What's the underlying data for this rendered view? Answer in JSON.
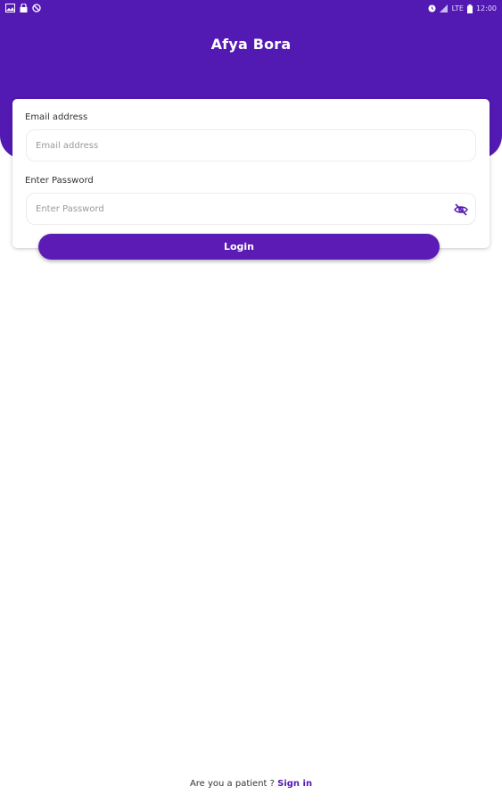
{
  "status_bar": {
    "left_icons": [
      "image-icon",
      "lock-icon",
      "no-sync-icon"
    ],
    "right_icons": [
      "alarm-icon",
      "signal-icon",
      "battery-icon"
    ],
    "network_label": "LTE",
    "time": "12:00"
  },
  "header": {
    "title": "Afya Bora",
    "background_color": "#5319b3"
  },
  "form": {
    "email": {
      "label": "Email address",
      "placeholder": "Email address",
      "value": ""
    },
    "password": {
      "label": "Enter Password",
      "placeholder": "Enter Password",
      "value": "",
      "toggle_icon": "eye-off-icon"
    },
    "login_label": "Login"
  },
  "footer": {
    "prompt": "Are you a patient ? ",
    "link_label": "Sign in"
  },
  "colors": {
    "primary": "#5319b3",
    "button": "#5d1bb5",
    "link": "#5319b3"
  }
}
